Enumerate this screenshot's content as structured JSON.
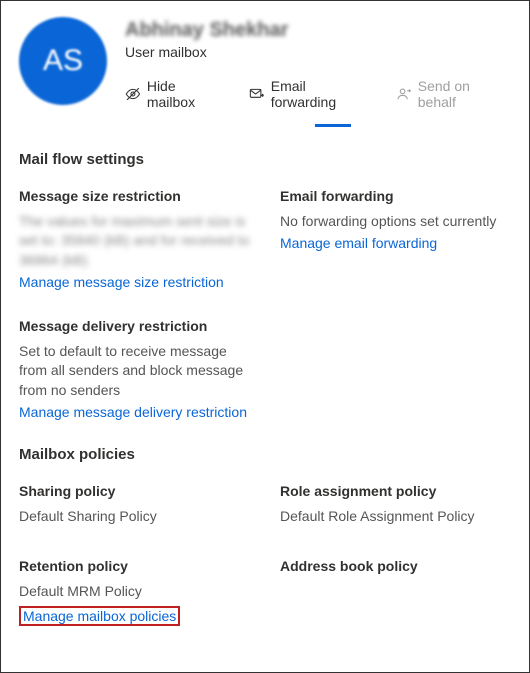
{
  "user": {
    "initials": "AS",
    "name": "Abhinay Shekhar",
    "type": "User mailbox"
  },
  "actions": {
    "hide_mailbox": "Hide mailbox",
    "email_forwarding": "Email forwarding",
    "send_on_behalf": "Send on behalf"
  },
  "sections": {
    "mail_flow": "Mail flow settings",
    "mailbox_policies": "Mailbox policies"
  },
  "blocks": {
    "msg_size": {
      "title": "Message size restriction",
      "desc": "The values for maximum sent size is set to: 35840 (kB) and for received to 36864 (kB)",
      "link": "Manage message size restriction"
    },
    "email_fwd": {
      "title": "Email forwarding",
      "desc": "No forwarding options set currently",
      "link": "Manage email forwarding"
    },
    "msg_delivery": {
      "title": "Message delivery restriction",
      "desc": "Set to default to receive message from all senders and block message from no senders",
      "link": "Manage message delivery restriction"
    },
    "sharing": {
      "title": "Sharing policy",
      "desc": "Default Sharing Policy"
    },
    "role": {
      "title": "Role assignment policy",
      "desc": "Default Role Assignment Policy"
    },
    "retention": {
      "title": "Retention policy",
      "desc": "Default MRM Policy",
      "link": "Manage mailbox policies"
    },
    "address": {
      "title": "Address book policy"
    }
  }
}
